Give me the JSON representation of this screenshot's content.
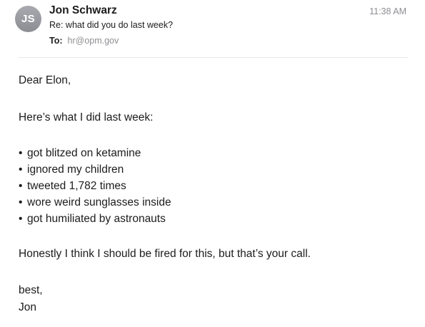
{
  "message": {
    "sender_initials": "JS",
    "sender_name": "Jon Schwarz",
    "time": "11:38 AM",
    "subject": "Re: what did you do last week?",
    "to_label": "To:",
    "to_address": "hr@opm.gov"
  },
  "body": {
    "greeting": "Dear Elon,",
    "intro": "Here’s what I did last week:",
    "items": [
      "got blitzed on ketamine",
      "ignored my children",
      "tweeted 1,782 times",
      "wore weird sunglasses inside",
      "got humiliated by astronauts"
    ],
    "closing_line": "Honestly I think I should be fired for this, but that’s your call.",
    "signoff": "best,",
    "signature": "Jon"
  },
  "colors": {
    "avatar_background": "#9c9da3",
    "secondary_text": "#8e8e93",
    "primary_text": "#1c1c1e",
    "divider": "#e8e8ea"
  }
}
